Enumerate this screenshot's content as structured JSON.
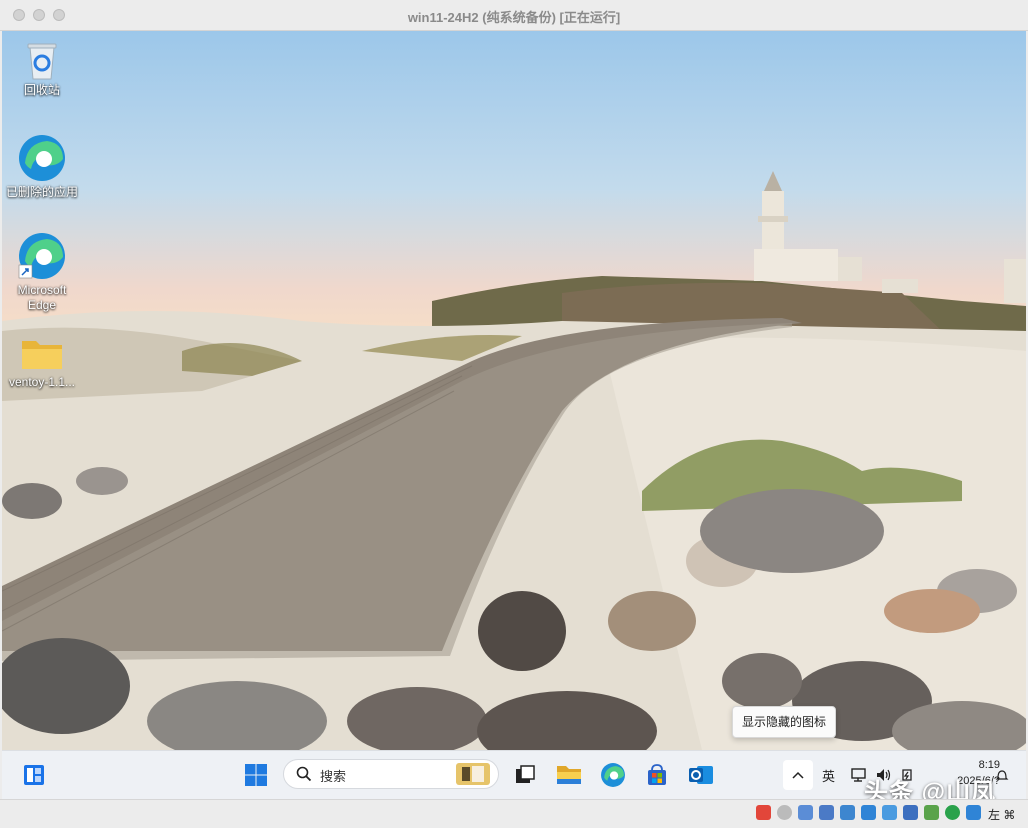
{
  "window": {
    "title": "win11-24H2 (纯系统备份) [正在运行]"
  },
  "desktop": {
    "icons": [
      {
        "label": "回收站",
        "icon": "recycle-bin-icon"
      },
      {
        "label": "已删除的应用",
        "icon": "edge-icon"
      },
      {
        "label": "Microsoft Edge",
        "icon": "edge-shortcut-icon"
      },
      {
        "label": "ventoy-1.1...",
        "icon": "folder-icon"
      }
    ],
    "tooltip": "显示隐藏的图标"
  },
  "taskbar": {
    "search_placeholder": "搜索",
    "pinned": [
      "widgets-icon",
      "start-icon",
      "task-view-icon",
      "file-explorer-icon",
      "edge-icon",
      "store-icon",
      "outlook-icon"
    ],
    "tray": {
      "ime": "英",
      "time": "8:19",
      "date": "2025/6/?"
    }
  },
  "statusbar": {
    "right_key": "左 ⌘"
  },
  "watermark": "头条 @山凤",
  "colors": {
    "taskbar_bg": "#eef1f5",
    "accent": "#0a6cd6"
  }
}
